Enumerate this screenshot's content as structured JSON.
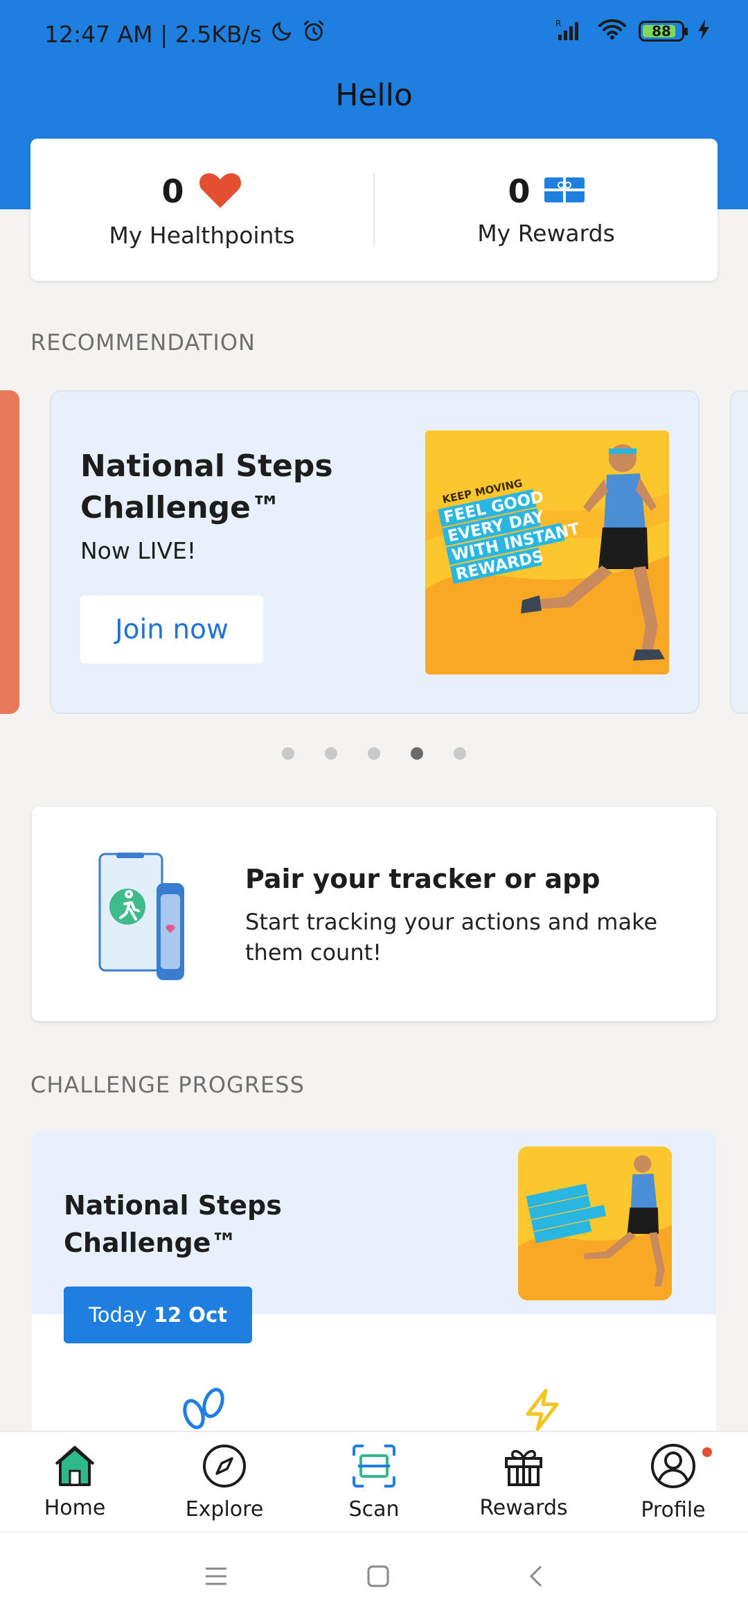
{
  "status_bar": {
    "time": "12:47 AM | 2.5KB/s",
    "battery": "88",
    "battery_level": 0.88
  },
  "header": {
    "title": "Hello"
  },
  "points": {
    "healthpoints_value": "0",
    "healthpoints_label": "My Healthpoints",
    "rewards_value": "0",
    "rewards_label": "My Rewards"
  },
  "recommendation": {
    "section_title": "RECOMMENDATION",
    "card_title": "National Steps Challenge™",
    "card_subtitle": "Now LIVE!",
    "cta_label": "Join now",
    "banner": {
      "tag": "KEEP MOVING",
      "lines": [
        "FEEL GOOD",
        "EVERY DAY",
        "WITH INSTANT",
        "REWARDS"
      ]
    },
    "carousel_active_index": 3,
    "carousel_count": 5
  },
  "pair": {
    "title": "Pair your tracker or app",
    "description": "Start tracking your actions and make them count!"
  },
  "challenge_progress": {
    "section_title": "CHALLENGE PROGRESS",
    "card_title": "National Steps Challenge™",
    "today_label": "Today",
    "today_date": "12 Oct"
  },
  "bottom_nav": {
    "items": [
      {
        "label": "Home",
        "icon": "home-icon"
      },
      {
        "label": "Explore",
        "icon": "compass-icon"
      },
      {
        "label": "Scan",
        "icon": "scan-icon"
      },
      {
        "label": "Rewards",
        "icon": "gift-icon"
      },
      {
        "label": "Profile",
        "icon": "profile-icon"
      }
    ]
  },
  "colors": {
    "brand_blue": "#1e7fe0",
    "heart_orange": "#e4502f",
    "card_blue_bg": "#e8f1fb",
    "banner_yellow": "#fcc72c"
  }
}
